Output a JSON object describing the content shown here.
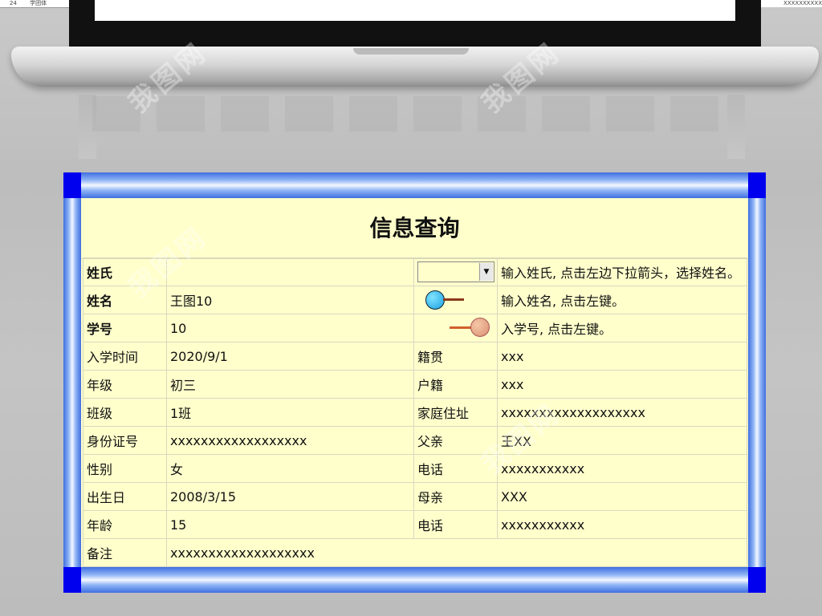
{
  "window": {
    "sheet_row_num": "24",
    "sheet_row_text": "学团体",
    "sheet_right_text": "XXXXXXXXXX",
    "watermark": "我图网"
  },
  "form": {
    "title": "信息查询",
    "rows": [
      {
        "l1": "姓氏",
        "v1": "",
        "l2": "",
        "v2": "输入姓氏, 点击左边下拉箭头，选择姓名。"
      },
      {
        "l1": "姓名",
        "v1": "王图10",
        "l2": "",
        "v2": "输入姓名, 点击左键。"
      },
      {
        "l1": "学号",
        "v1": "10",
        "l2": "",
        "v2": "入学号, 点击左键。"
      },
      {
        "l1": "入学时间",
        "v1": "2020/9/1",
        "l2": "籍贯",
        "v2": "xxx"
      },
      {
        "l1": "年级",
        "v1": "初三",
        "l2": "户籍",
        "v2": "xxx"
      },
      {
        "l1": "班级",
        "v1": "1班",
        "l2": "家庭住址",
        "v2": "xxxxxxxxxxxxxxxxxxx"
      },
      {
        "l1": "身份证号",
        "v1": "xxxxxxxxxxxxxxxxxx",
        "l2": "父亲",
        "v2": "王XX"
      },
      {
        "l1": "性别",
        "v1": "女",
        "l2": "电话",
        "v2": "xxxxxxxxxxx"
      },
      {
        "l1": "出生日",
        "v1": "2008/3/15",
        "l2": "母亲",
        "v2": "XXX"
      },
      {
        "l1": "年龄",
        "v1": "15",
        "l2": "电话",
        "v2": "xxxxxxxxxxx"
      },
      {
        "l1": "备注",
        "v1": "xxxxxxxxxxxxxxxxxxx",
        "l2": "",
        "v2": ""
      }
    ],
    "dropdown_value": "",
    "dropdown_icon": "chevron-down-icon",
    "name_button_icon": "blue-ball-button-icon",
    "id_button_icon": "orange-ball-button-icon"
  },
  "colors": {
    "panel_bg": "#ffffcc",
    "frame_blue": "#0000ee",
    "label_blue": "#0000dd",
    "label_red": "#cc0000"
  }
}
